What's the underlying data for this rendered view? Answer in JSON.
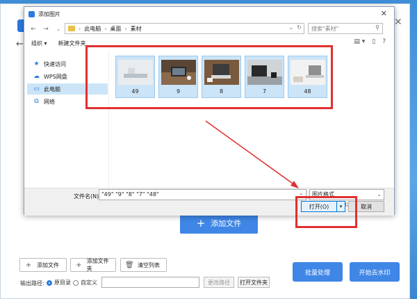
{
  "app": {
    "add_file_big": "添加文件",
    "add_file": "添加文件",
    "add_folder": "添加文件夹",
    "clear_list": "清空列表",
    "output_path_label": "输出路径:",
    "radio_original": "原目录",
    "radio_custom": "自定义",
    "change_path": "更改路径",
    "open_folder": "打开文件夹",
    "batch_process": "批量处理",
    "start_watermark": "开始去水印"
  },
  "dialog": {
    "title": "添加图片",
    "breadcrumb": [
      "此电脑",
      "桌面",
      "素材"
    ],
    "search_placeholder": "搜索\"素材\"",
    "toolbar": {
      "organize": "组织 ▾",
      "new_folder": "新建文件夹"
    },
    "sidebar": [
      {
        "label": "快速访问",
        "icon": "star-icon"
      },
      {
        "label": "WPS网盘",
        "icon": "cloud-icon"
      },
      {
        "label": "此电脑",
        "icon": "computer-icon",
        "selected": true
      },
      {
        "label": "网络",
        "icon": "network-icon"
      }
    ],
    "files": [
      {
        "name": "49",
        "selected": true
      },
      {
        "name": "9",
        "selected": true
      },
      {
        "name": "8",
        "selected": true
      },
      {
        "name": "7",
        "selected": true
      },
      {
        "name": "48",
        "selected": true
      }
    ],
    "filename_label": "文件名(N):",
    "filename_value": "\"49\" \"9\" \"8\" \"7\" \"48\"",
    "filter_value": "图片格式(*.bmp;*.jpg;*.png)",
    "open_label": "打开(O)",
    "cancel_label": "取消"
  },
  "colors": {
    "accent": "#3f86e6",
    "annotation": "#e03030",
    "selection": "#cce4f7"
  }
}
